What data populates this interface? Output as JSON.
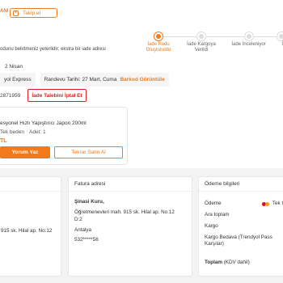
{
  "header": {
    "seller_partial": "ANI",
    "follow_label": "Takip et",
    "follow_icon": "plus-icon"
  },
  "tracker": {
    "steps": [
      {
        "label_line1": "İade Kodu",
        "label_line2": "Oluşturuldu",
        "active": true
      },
      {
        "label_line1": "İade Kargoya",
        "label_line2": "Verildi",
        "active": false
      },
      {
        "label_line1": "İade İnceleniyor",
        "label_line2": "",
        "active": false
      },
      {
        "label_line1": "İ",
        "label_line2": "",
        "active": false
      }
    ]
  },
  "notice": "odunu belirtmeniz yeterlidir; ekstra bir iade adresi",
  "return_date": "2 Nisan",
  "cargo": {
    "company": "yol Express",
    "appointment": "Randevu Tarihi: 27 Mart, Cuma",
    "barcode_link": "Barkod Görüntüle"
  },
  "return_code": "2871959",
  "cancel_label": "İade Talebini İptal Et",
  "product": {
    "name": "esyonel Hızlı Yapıştırıcı Japon 200ml",
    "size": "Tek beden",
    "quantity": "Adet: 1",
    "price": "TL",
    "review_label": "Yorum Yaz",
    "rebuy_label": "Tekrar Satın Al"
  },
  "delivery_address": {
    "line1": "915 sk. Hilal ap. No:12"
  },
  "billing_address": {
    "title": "Fatura adresi",
    "name": "Şinasi Kuru,",
    "line1": "Öğretmenevleri mah. 915 sk. Hilal ap. No:12",
    "line2": "D:2",
    "city": "Antalya",
    "phone": "532*****56"
  },
  "payment": {
    "title": "Ödeme bilgileri",
    "method_label": "Ödeme",
    "method_value": "Tek Ç",
    "subtotal": "Ara toplam",
    "cargo": "Kargo",
    "free_cargo_line1": "Kargo Bedava (Trendyol Pass",
    "free_cargo_line2": "Karşılar)",
    "total": "Toplam",
    "total_note": "(KDV dahil)"
  },
  "colors": {
    "accent": "#f27a1a",
    "danger": "#e01e1e"
  }
}
